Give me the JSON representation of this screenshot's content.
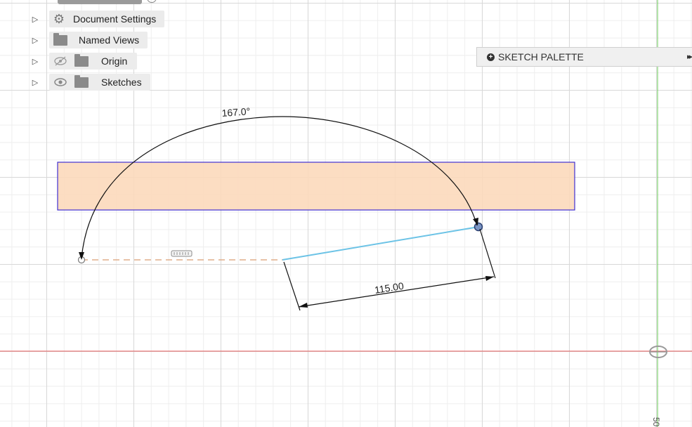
{
  "browser": {
    "items": [
      {
        "label": "Document Settings",
        "icon": "gear-icon"
      },
      {
        "label": "Named Views",
        "icon": "folder-icon"
      },
      {
        "label": "Origin",
        "icon": "folder-icon",
        "visibility": "hidden-eye-icon"
      },
      {
        "label": "Sketches",
        "icon": "folder-icon",
        "visibility": "eye-icon"
      }
    ]
  },
  "palette": {
    "title": "SKETCH PALETTE",
    "collapse_glyph": "▸▸"
  },
  "sketch": {
    "angle_dimension": "167.0°",
    "linear_dimension": "115.00",
    "ruler_value": "50"
  },
  "colors": {
    "rect_fill": "#fcd9bb",
    "rect_stroke": "#3f2fd1",
    "line": "#6cc3e6",
    "dimension": "#111111",
    "x_axis": "#e55555",
    "y_axis": "#66cc55",
    "construction": "#e0ad8a"
  }
}
